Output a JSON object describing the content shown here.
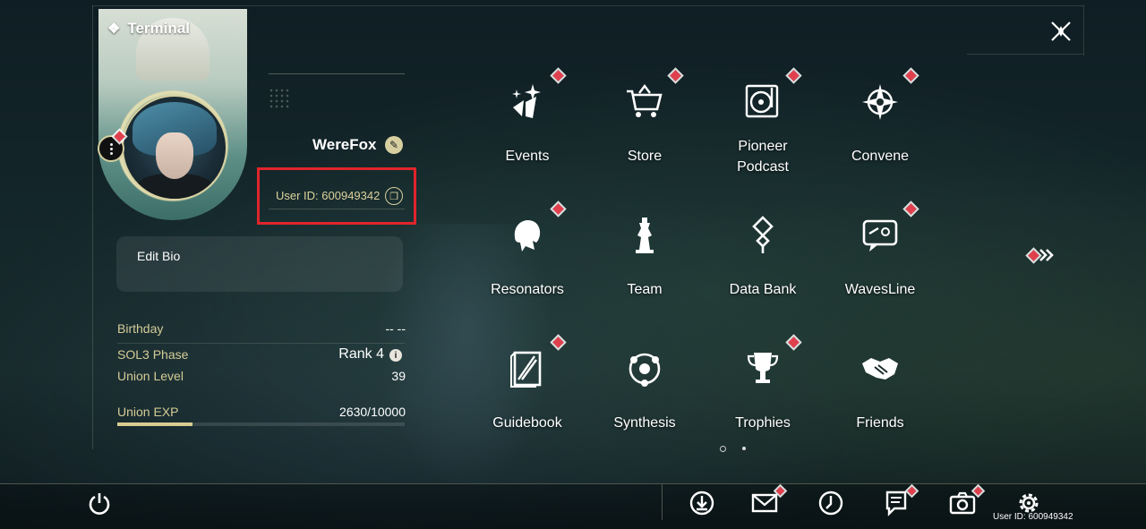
{
  "terminal": {
    "title": "Terminal",
    "icon": "diamond-cluster-icon"
  },
  "profile": {
    "username": "WereFox",
    "user_id_text": "User ID: 600949342",
    "edit_bio_label": "Edit Bio"
  },
  "stats": {
    "birthday_label": "Birthday",
    "birthday_value": "-- --",
    "sol3_label": "SOL3 Phase",
    "sol3_value": "Rank 4",
    "union_level_label": "Union Level",
    "union_level_value": "39",
    "union_exp_label": "Union EXP",
    "union_exp_value": "2630/10000",
    "union_exp_progress": 0.263
  },
  "menu": [
    {
      "label": "Events",
      "icon": "sparkle-shards-icon",
      "badge": true
    },
    {
      "label": "Store",
      "icon": "shopping-cart-icon",
      "badge": true
    },
    {
      "label": "Pioneer\nPodcast",
      "icon": "record-player-icon",
      "badge": true
    },
    {
      "label": "Convene",
      "icon": "compass-star-icon",
      "badge": true
    },
    {
      "label": "Resonators",
      "icon": "character-head-icon",
      "badge": true
    },
    {
      "label": "Team",
      "icon": "chess-pieces-icon",
      "badge": false
    },
    {
      "label": "Data Bank",
      "icon": "data-bank-icon",
      "badge": false
    },
    {
      "label": "WavesLine",
      "icon": "chat-bubble-icon",
      "badge": true
    },
    {
      "label": "Guidebook",
      "icon": "guidebook-icon",
      "badge": true
    },
    {
      "label": "Synthesis",
      "icon": "synthesis-orb-icon",
      "badge": false
    },
    {
      "label": "Trophies",
      "icon": "trophy-icon",
      "badge": true
    },
    {
      "label": "Friends",
      "icon": "handshake-icon",
      "badge": false
    }
  ],
  "bottom_bar": {
    "buttons": [
      "download-icon",
      "mail-icon",
      "clock-icon",
      "notice-icon",
      "camera-icon",
      "settings-icon"
    ],
    "footer_uid": "User ID: 600949342"
  },
  "colors": {
    "accent_gold": "#d9cc92",
    "badge_red": "#e0404e",
    "highlight_red": "#e0252b"
  }
}
